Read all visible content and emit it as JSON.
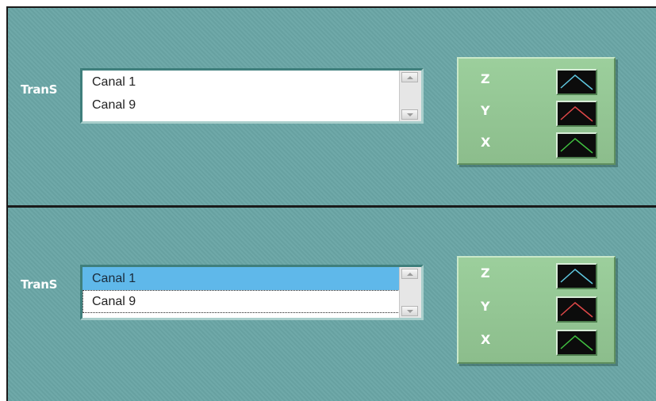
{
  "panels": [
    {
      "label": "TranS",
      "list": {
        "items": [
          {
            "text": "Canal 1",
            "selected": false,
            "focused": false
          },
          {
            "text": "Canal 9",
            "selected": false,
            "focused": false
          }
        ]
      },
      "legend": {
        "rows": [
          {
            "axis": "Z",
            "color": "#5fc8e0"
          },
          {
            "axis": "Y",
            "color": "#e04848"
          },
          {
            "axis": "X",
            "color": "#40c040"
          }
        ]
      }
    },
    {
      "label": "TranS",
      "list": {
        "items": [
          {
            "text": "Canal 1",
            "selected": true,
            "focused": false
          },
          {
            "text": "Canal 9",
            "selected": false,
            "focused": true
          }
        ]
      },
      "legend": {
        "rows": [
          {
            "axis": "Z",
            "color": "#5fc8e0"
          },
          {
            "axis": "Y",
            "color": "#e04848"
          },
          {
            "axis": "X",
            "color": "#40c040"
          }
        ]
      }
    }
  ],
  "icons": {
    "scroll_up": "scroll-up-arrow-icon",
    "scroll_down": "scroll-down-arrow-icon",
    "plot": "plot-line-icon"
  }
}
